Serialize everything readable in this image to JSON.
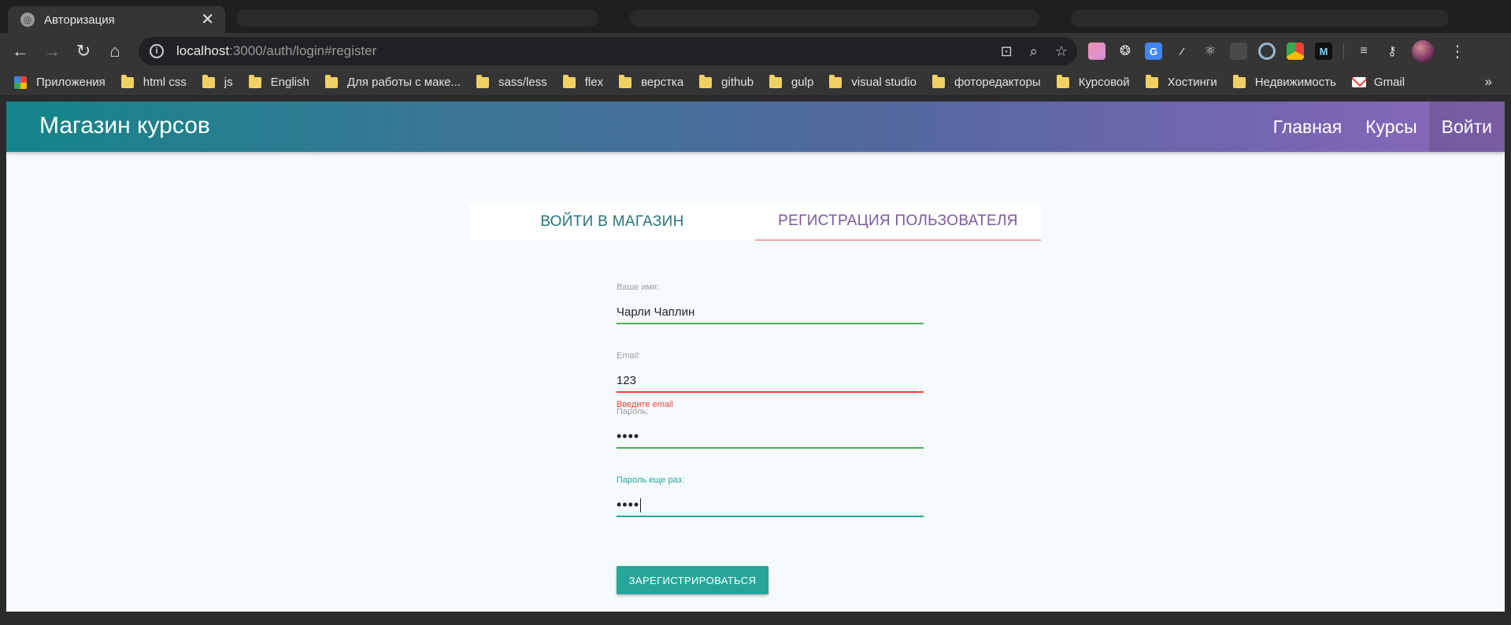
{
  "browser": {
    "tab": {
      "title": "Авторизация",
      "close": "✕"
    },
    "url": {
      "host": "localhost",
      "rest": ":3000/auth/login#register"
    },
    "bookmarks": [
      {
        "label": "Приложения",
        "icon": "apps-grid-icon"
      },
      {
        "label": "html css",
        "icon": "folder-icon"
      },
      {
        "label": "js",
        "icon": "folder-icon"
      },
      {
        "label": "English",
        "icon": "folder-icon"
      },
      {
        "label": "Для работы с маке...",
        "icon": "folder-icon"
      },
      {
        "label": "sass/less",
        "icon": "folder-icon"
      },
      {
        "label": "flex",
        "icon": "folder-icon"
      },
      {
        "label": "верстка",
        "icon": "folder-icon"
      },
      {
        "label": "github",
        "icon": "folder-icon"
      },
      {
        "label": "gulp",
        "icon": "folder-icon"
      },
      {
        "label": "visual studio",
        "icon": "folder-icon"
      },
      {
        "label": "фоторедакторы",
        "icon": "folder-icon"
      },
      {
        "label": "Курсовой",
        "icon": "folder-icon"
      },
      {
        "label": "Хостинги",
        "icon": "folder-icon"
      },
      {
        "label": "Недвижимость",
        "icon": "folder-icon"
      },
      {
        "label": "Gmail",
        "icon": "gmail-icon"
      }
    ],
    "bookmarks_more": "»"
  },
  "app": {
    "brand": "Магазин курсов",
    "nav": {
      "home": "Главная",
      "courses": "Курсы",
      "login": "Войти"
    },
    "tabs": {
      "login": "ВОЙТИ В МАГАЗИН",
      "register": "РЕГИСТРАЦИЯ ПОЛЬЗОВАТЕЛЯ"
    },
    "form": {
      "name": {
        "label": "Ваше имя:",
        "value": "Чарли Чаплин"
      },
      "email": {
        "label": "Email:",
        "value": "123",
        "error": "Введите email"
      },
      "password": {
        "label": "Пароль:",
        "value": "••••"
      },
      "password2": {
        "label": "Пароль еще раз:",
        "value": "••••"
      }
    },
    "submit": "ЗАРЕГИСТРИРОВАТЬСЯ"
  },
  "colors": {
    "accent": "#26a69a",
    "valid": "#4caf50",
    "invalid": "#f44336",
    "login_tab": "#26777a",
    "register_tab": "#7b5a9e"
  }
}
